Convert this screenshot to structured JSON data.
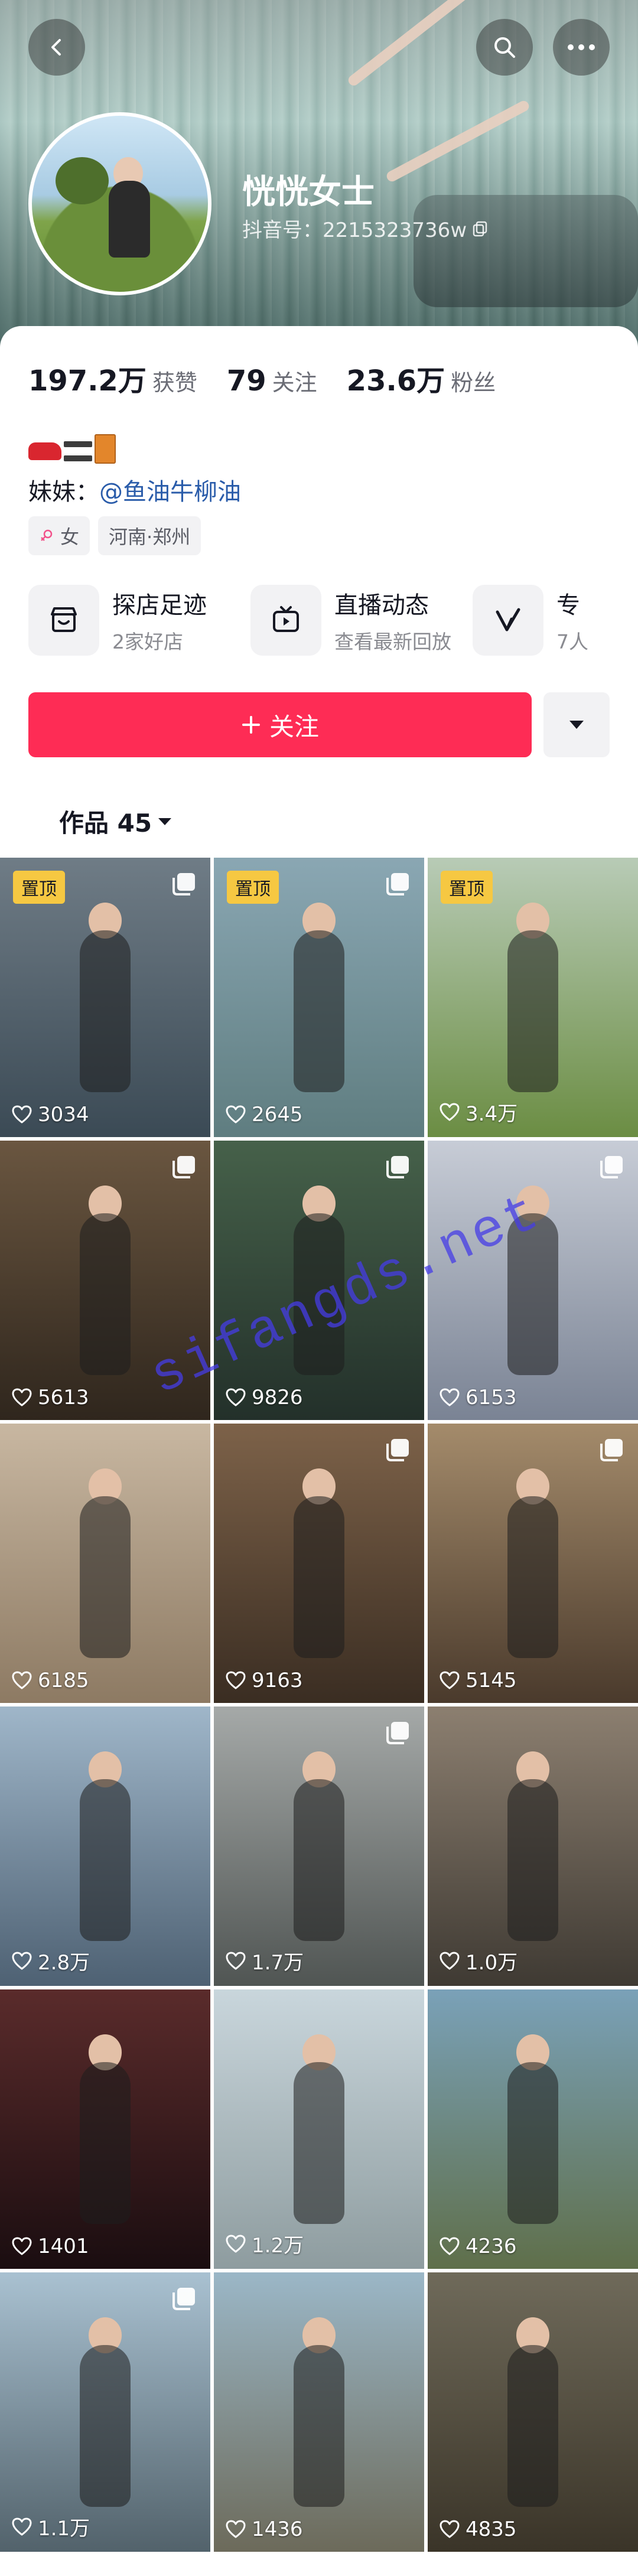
{
  "profile": {
    "name": "恍恍女士",
    "douyin_id": "抖音号：2215323736w",
    "stats": [
      {
        "value": "197.2万",
        "label": "获赞"
      },
      {
        "value": "79",
        "label": "关注"
      },
      {
        "value": "23.6万",
        "label": "粉丝"
      }
    ],
    "bio_prefix": "妹妹：",
    "bio_link": "@鱼油牛柳油",
    "tags": {
      "gender": "女",
      "location": "河南·郑州"
    }
  },
  "features": [
    {
      "title": "探店足迹",
      "subtitle": "2家好店",
      "icon": "store-icon"
    },
    {
      "title": "直播动态",
      "subtitle": "查看最新回放",
      "icon": "tv-icon"
    },
    {
      "title": "专",
      "subtitle": "7人",
      "icon": "v-icon"
    }
  ],
  "follow_label": "关注",
  "works_tab": "作品 45",
  "videos": [
    {
      "likes": "3034",
      "pinned": true,
      "multi": true,
      "colors": [
        "#6f7c86",
        "#3b4a55"
      ]
    },
    {
      "likes": "2645",
      "pinned": true,
      "multi": true,
      "colors": [
        "#8aa7b3",
        "#5f7d80"
      ]
    },
    {
      "likes": "3.4万",
      "pinned": true,
      "multi": false,
      "colors": [
        "#b8cbb6",
        "#6b8d43"
      ]
    },
    {
      "likes": "5613",
      "pinned": false,
      "multi": true,
      "colors": [
        "#6a5640",
        "#2f261d"
      ]
    },
    {
      "likes": "9826",
      "pinned": false,
      "multi": true,
      "colors": [
        "#46614a",
        "#23302a"
      ]
    },
    {
      "likes": "6153",
      "pinned": false,
      "multi": true,
      "colors": [
        "#c7ccd6",
        "#7a8394"
      ]
    },
    {
      "likes": "6185",
      "pinned": false,
      "multi": false,
      "colors": [
        "#c8b7a1",
        "#8d7a63"
      ]
    },
    {
      "likes": "9163",
      "pinned": false,
      "multi": true,
      "colors": [
        "#7d6249",
        "#3a2d22"
      ]
    },
    {
      "likes": "5145",
      "pinned": false,
      "multi": true,
      "colors": [
        "#a48b6b",
        "#4a3a2c"
      ]
    },
    {
      "likes": "2.8万",
      "pinned": false,
      "multi": false,
      "colors": [
        "#9fb6c9",
        "#4e6173"
      ]
    },
    {
      "likes": "1.7万",
      "pinned": false,
      "multi": true,
      "colors": [
        "#a5a9a8",
        "#505553"
      ]
    },
    {
      "likes": "1.0万",
      "pinned": false,
      "multi": false,
      "colors": [
        "#8c7f70",
        "#3f3a33"
      ]
    },
    {
      "likes": "1401",
      "pinned": false,
      "multi": false,
      "colors": [
        "#5a2b2b",
        "#1a0d10"
      ]
    },
    {
      "likes": "1.2万",
      "pinned": false,
      "multi": false,
      "colors": [
        "#c9d6dc",
        "#8e9c9f"
      ]
    },
    {
      "likes": "4236",
      "pinned": false,
      "multi": false,
      "colors": [
        "#7aa1b8",
        "#5f6f4a"
      ]
    },
    {
      "likes": "1.1万",
      "pinned": false,
      "multi": true,
      "colors": [
        "#a9c1d1",
        "#52626b"
      ]
    },
    {
      "likes": "1436",
      "pinned": false,
      "multi": false,
      "colors": [
        "#9bb7c7",
        "#6c6a5a"
      ]
    },
    {
      "likes": "4835",
      "pinned": false,
      "multi": false,
      "colors": [
        "#6f6a5a",
        "#3a3428"
      ]
    }
  ],
  "pinned_label": "置顶",
  "watermark": "sifangds.net",
  "colors": {
    "accent": "#fe2c55",
    "link": "#2a5caa",
    "pin": "#f6c842"
  }
}
